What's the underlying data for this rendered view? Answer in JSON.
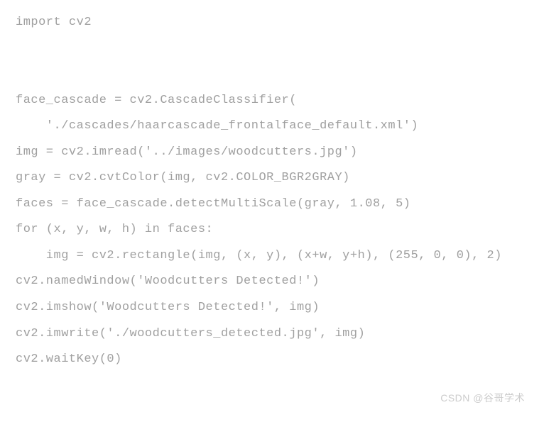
{
  "code": {
    "line1": "import cv2",
    "line2": "face_cascade = cv2.CascadeClassifier(",
    "line3": "    './cascades/haarcascade_frontalface_default.xml')",
    "line4": "img = cv2.imread('../images/woodcutters.jpg')",
    "line5": "gray = cv2.cvtColor(img, cv2.COLOR_BGR2GRAY)",
    "line6": "faces = face_cascade.detectMultiScale(gray, 1.08, 5)",
    "line7": "for (x, y, w, h) in faces:",
    "line8": "    img = cv2.rectangle(img, (x, y), (x+w, y+h), (255, 0, 0), 2)",
    "line9": "cv2.namedWindow('Woodcutters Detected!')",
    "line10": "cv2.imshow('Woodcutters Detected!', img)",
    "line11": "cv2.imwrite('./woodcutters_detected.jpg', img)",
    "line12": "cv2.waitKey(0)"
  },
  "watermark": "CSDN @谷哥学术"
}
